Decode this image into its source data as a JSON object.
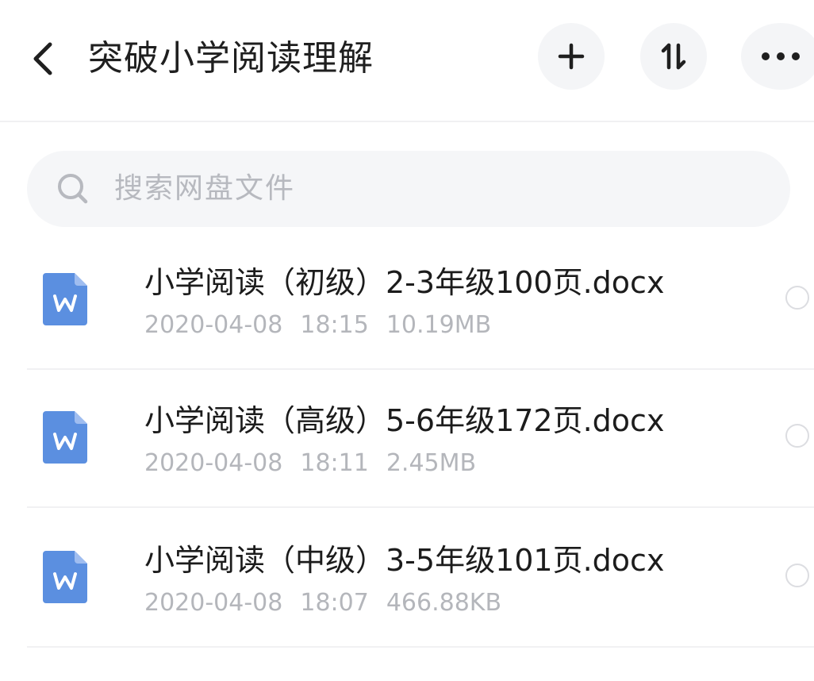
{
  "header": {
    "title": "突破小学阅读理解",
    "back_icon": "back-chevron-icon",
    "add_icon": "plus-icon",
    "sort_icon": "sort-arrows-icon",
    "more_icon": "more-dots-icon"
  },
  "search": {
    "placeholder": "搜索网盘文件",
    "icon": "search-icon"
  },
  "files": [
    {
      "name": "小学阅读（初级）2-3年级100页.docx",
      "date": "2020-04-08",
      "time": "18:15",
      "size": "10.19MB",
      "icon": "word-doc-icon"
    },
    {
      "name": "小学阅读（高级）5-6年级172页.docx",
      "date": "2020-04-08",
      "time": "18:11",
      "size": "2.45MB",
      "icon": "word-doc-icon"
    },
    {
      "name": "小学阅读（中级）3-5年级101页.docx",
      "date": "2020-04-08",
      "time": "18:07",
      "size": "466.88KB",
      "icon": "word-doc-icon"
    }
  ],
  "colors": {
    "doc_icon_blue": "#5b8fe0",
    "doc_icon_fold": "#9fbdf0",
    "meta_text": "#b4b6bb",
    "button_bg": "#f4f5f7"
  }
}
